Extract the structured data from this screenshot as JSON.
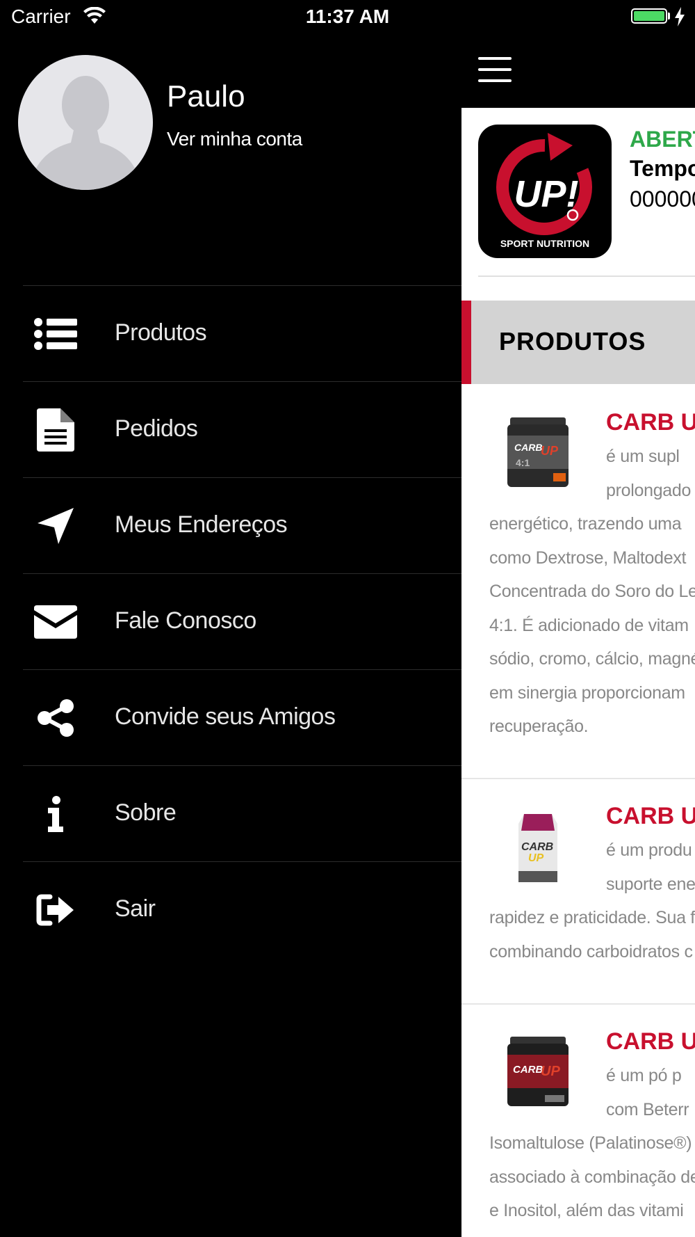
{
  "status_bar": {
    "carrier": "Carrier",
    "time": "11:37 AM"
  },
  "drawer": {
    "user_name": "Paulo",
    "account_link": "Ver minha conta",
    "menu": [
      {
        "label": "Produtos",
        "icon": "list-icon"
      },
      {
        "label": "Pedidos",
        "icon": "document-icon"
      },
      {
        "label": "Meus Endereços",
        "icon": "location-arrow-icon"
      },
      {
        "label": "Fale Conosco",
        "icon": "envelope-icon"
      },
      {
        "label": "Convide seus Amigos",
        "icon": "share-icon"
      },
      {
        "label": "Sobre",
        "icon": "info-icon"
      },
      {
        "label": "Sair",
        "icon": "sign-out-icon"
      }
    ]
  },
  "main": {
    "store": {
      "status": "ABERT",
      "time_label": "Tempo",
      "time_value": "000000",
      "logo_text": "UP!",
      "logo_subtext": "SPORT NUTRITION"
    },
    "section_title": "PRODUTOS",
    "products": [
      {
        "name": "CARB U",
        "lines": [
          "é um supl",
          "prolongado",
          "energético, trazendo uma",
          "como Dextrose, Maltodext",
          "Concentrada do Soro do Le",
          "4:1. É adicionado de vitam",
          "sódio, cromo, cálcio, magné",
          "em sinergia proporcionam",
          "recuperação."
        ]
      },
      {
        "name": "CARB U",
        "lines": [
          "é um produ",
          "suporte ene",
          "rapidez e praticidade. Sua fo",
          "combinando carboidratos c"
        ]
      },
      {
        "name": "CARB U",
        "lines": [
          "é um pó p",
          "com Beterr",
          "Isomaltulose (Palatinose®)",
          "associado à combinação de",
          "e Inositol, além das vitami"
        ]
      }
    ]
  },
  "colors": {
    "accent_red": "#c8102e",
    "open_green": "#2ea84a",
    "battery_green": "#4cd964"
  }
}
